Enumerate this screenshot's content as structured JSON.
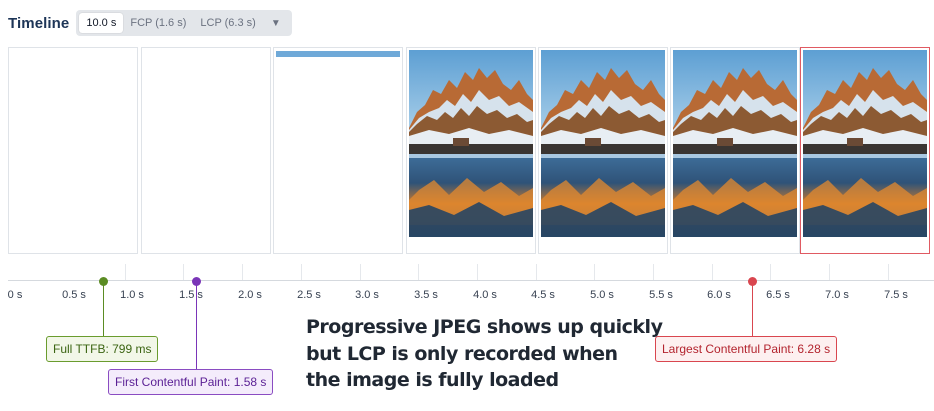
{
  "header": {
    "title": "Timeline",
    "tabs": [
      {
        "label": "10.0 s",
        "active": true
      },
      {
        "label": "FCP (1.6 s)",
        "active": false
      },
      {
        "label": "LCP (6.3 s)",
        "active": false
      }
    ],
    "dropdown_icon": "caret-down-icon"
  },
  "frames": [
    {
      "state": "blank"
    },
    {
      "state": "blank"
    },
    {
      "state": "loading-bar"
    },
    {
      "state": "image"
    },
    {
      "state": "image"
    },
    {
      "state": "image"
    },
    {
      "state": "image",
      "highlight": true
    }
  ],
  "axis": {
    "ticks": [
      "0 s",
      "0.5 s",
      "1.0 s",
      "1.5 s",
      "2.0 s",
      "2.5 s",
      "3.0 s",
      "3.5 s",
      "4.0 s",
      "4.5 s",
      "5.0 s",
      "5.5 s",
      "6.0 s",
      "6.5 s",
      "7.0 s",
      "7.5 s"
    ]
  },
  "markers": {
    "ttfb": {
      "label": "Full TTFB: 799 ms",
      "color": "#5b8c23"
    },
    "fcp": {
      "label": "First Contentful Paint: 1.58 s",
      "color": "#7a35b8"
    },
    "lcp": {
      "label": "Largest Contentful Paint: 6.28 s",
      "color": "#d9464f"
    }
  },
  "annotation": {
    "lines": [
      "Progressive JPEG shows up quickly",
      "but LCP is only recorded when",
      "the image is fully loaded"
    ]
  }
}
